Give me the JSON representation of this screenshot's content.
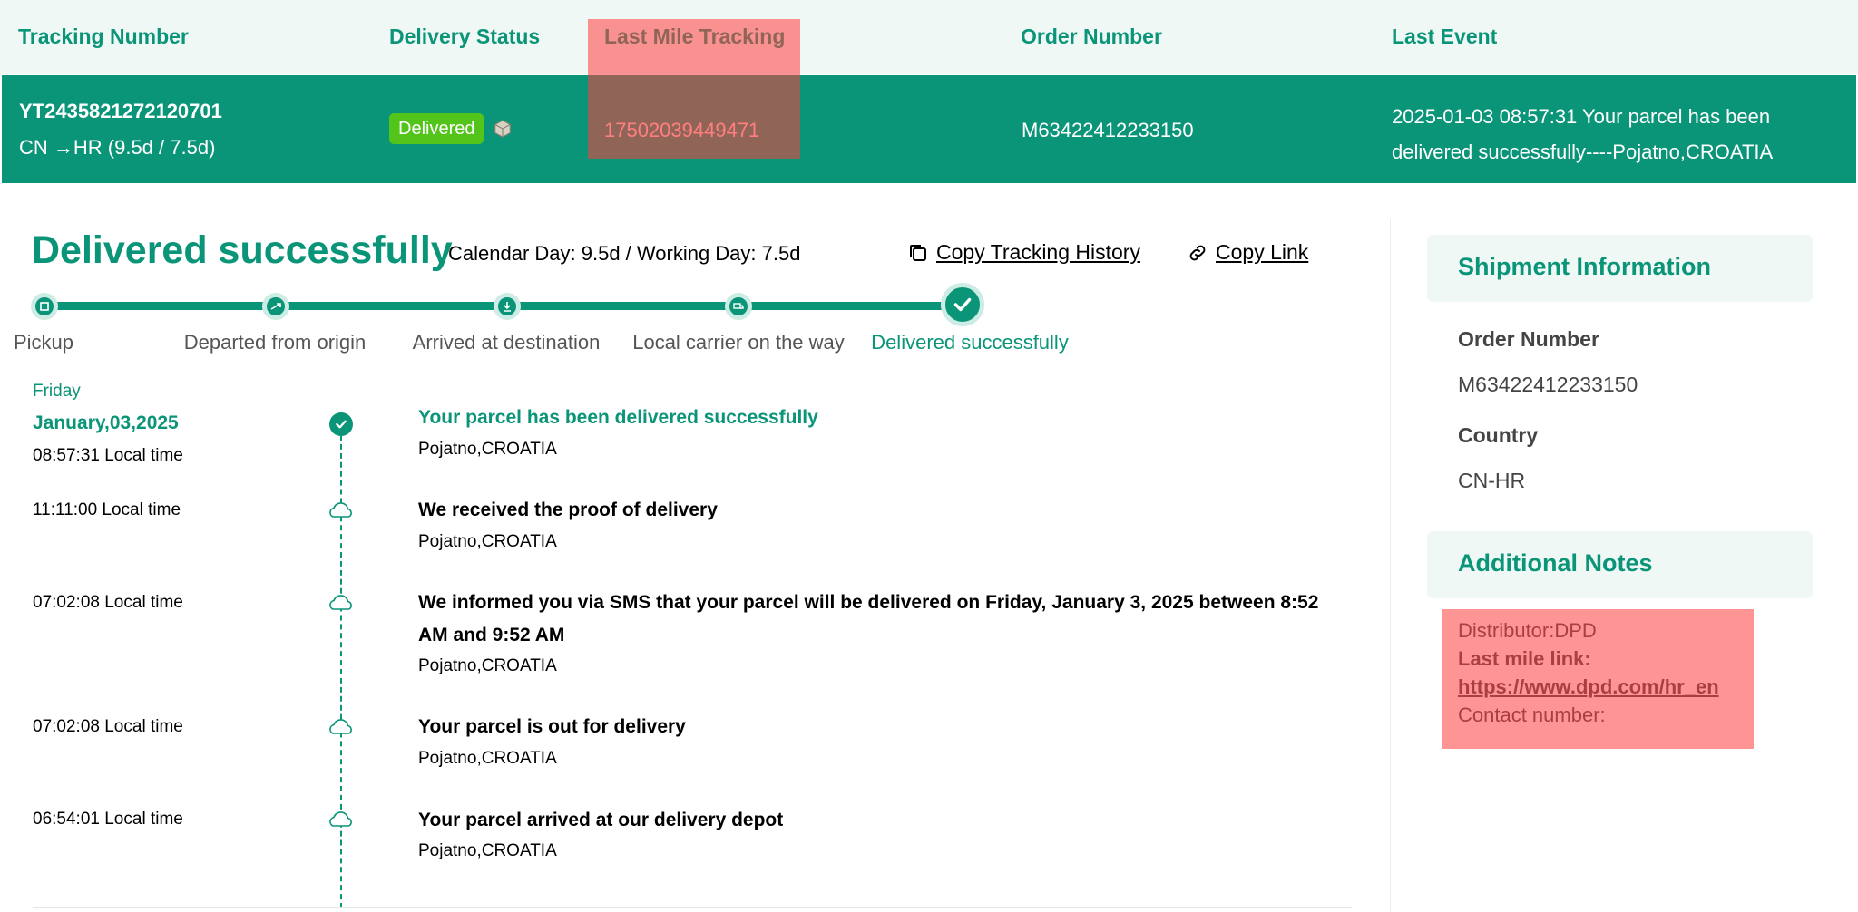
{
  "table": {
    "headers": [
      "Tracking Number",
      "Delivery Status",
      "Last Mile Tracking",
      "Order Number",
      "Last Event"
    ],
    "row": {
      "tracking_number": "YT2435821272120701",
      "route": "CN →HR (9.5d / 7.5d)",
      "status": "Delivered",
      "last_mile_tracking": "17502039449471",
      "order_number": "M63422412233150",
      "last_event": "2025-01-03 08:57:31 Your parcel has been delivered successfully----Pojatno,CROATIA"
    }
  },
  "summary": {
    "title": "Delivered successfully",
    "days": "Calendar Day: 9.5d / Working Day: 7.5d",
    "copy_history": "Copy Tracking History",
    "copy_link": "Copy Link"
  },
  "progress": {
    "steps": [
      "Pickup",
      "Departed from origin",
      "Arrived at destination",
      "Local carrier on the way",
      "Delivered successfully"
    ],
    "current_step": 5
  },
  "timeline": {
    "day_name": "Friday",
    "date": "January,03,2025",
    "events": [
      {
        "time": "08:57:31 Local time",
        "title": "Your parcel has been delivered successfully",
        "location": "Pojatno,CROATIA"
      },
      {
        "time": "11:11:00 Local time",
        "title": "We received the proof of delivery",
        "location": "Pojatno,CROATIA"
      },
      {
        "time": "07:02:08 Local time",
        "title": "We informed you via SMS that your parcel will be delivered on Friday, January 3, 2025 between 8:52 AM and 9:52 AM",
        "location": "Pojatno,CROATIA"
      },
      {
        "time": "07:02:08 Local time",
        "title": "Your parcel is out for delivery",
        "location": "Pojatno,CROATIA"
      },
      {
        "time": "06:54:01 Local time",
        "title": "Your parcel arrived at our delivery depot",
        "location": "Pojatno,CROATIA"
      }
    ]
  },
  "shipment": {
    "title": "Shipment Information",
    "order_label": "Order Number",
    "order_value": "M63422412233150",
    "country_label": "Country",
    "country_value": "CN-HR"
  },
  "notes": {
    "title": "Additional Notes",
    "distributor": "Distributor:DPD",
    "link_label": "Last mile link:",
    "link": "https://www.dpd.com/hr_en",
    "contact": "Contact number:"
  },
  "colors": {
    "accent": "#0a9478",
    "badge": "#52c41a",
    "highlight": "#ff3c3c"
  }
}
